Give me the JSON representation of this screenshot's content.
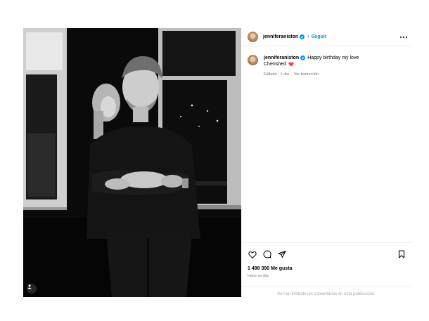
{
  "post": {
    "username": "jenniferaniston",
    "follow_label": "Seguir",
    "separator": "•",
    "caption_line1": "Happy birthday my love",
    "caption_line2": "Cherished",
    "edited_label": "Editado · 1 día",
    "translate_label": "Ver traducción",
    "likes_label": "1 498 390 Me gusta",
    "time_ago": "Hace un día",
    "comments_limited": "Se han limitado los comentarios en esta publicación."
  },
  "colors": {
    "accent": "#0095f6",
    "heart": "#ed4956",
    "muted": "#737373"
  },
  "icons": {
    "header": [
      "verified-badge-icon",
      "more-options-icon"
    ],
    "actions": [
      "heart-icon",
      "comment-icon",
      "share-icon",
      "bookmark-icon"
    ],
    "media": [
      "tagged-user-icon"
    ]
  }
}
